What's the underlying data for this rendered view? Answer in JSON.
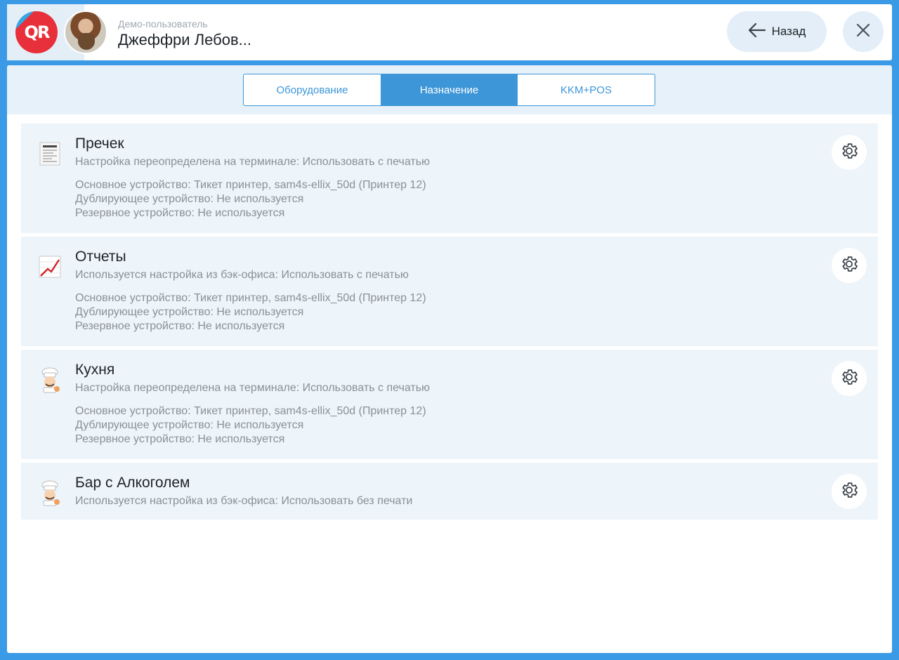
{
  "header": {
    "logo_text": "QR",
    "user_subtitle": "Демо-пользователь",
    "user_name": "Джеффри Лебов...",
    "back_label": "Назад"
  },
  "tabs": [
    {
      "label": "Оборудование",
      "active": false
    },
    {
      "label": "Назначение",
      "active": true
    },
    {
      "label": "KKM+POS",
      "active": false
    }
  ],
  "items": [
    {
      "title": "Пречек",
      "icon": "receipt-icon",
      "subtitle": "Настройка переопределена на терминале: Использовать с печатью",
      "details": [
        "Основное устройство: Тикет принтер, sam4s-ellix_50d (Принтер 12)",
        "Дублирующее устройство: Не используется",
        "Резервное устройство: Не используется"
      ]
    },
    {
      "title": "Отчеты",
      "icon": "chart-increasing-icon",
      "subtitle": "Используется настройка из бэк-офиса: Использовать с печатью",
      "details": [
        "Основное устройство: Тикет принтер, sam4s-ellix_50d (Принтер 12)",
        "Дублирующее устройство: Не используется",
        "Резервное устройство: Не используется"
      ]
    },
    {
      "title": "Кухня",
      "icon": "cook-icon",
      "subtitle": "Настройка переопределена на терминале: Использовать с печатью",
      "details": [
        "Основное устройство: Тикет принтер, sam4s-ellix_50d (Принтер 12)",
        "Дублирующее устройство: Не используется",
        "Резервное устройство: Не используется"
      ]
    },
    {
      "title": "Бар с Алкоголем",
      "icon": "cook-icon",
      "subtitle": "Используется настройка из бэк-офиса: Использовать без печати",
      "details": []
    }
  ],
  "colors": {
    "frame": "#3b9ae5",
    "accent": "#3d96d8",
    "card_bg": "#edf4fa",
    "logo_red": "#e8303a"
  }
}
